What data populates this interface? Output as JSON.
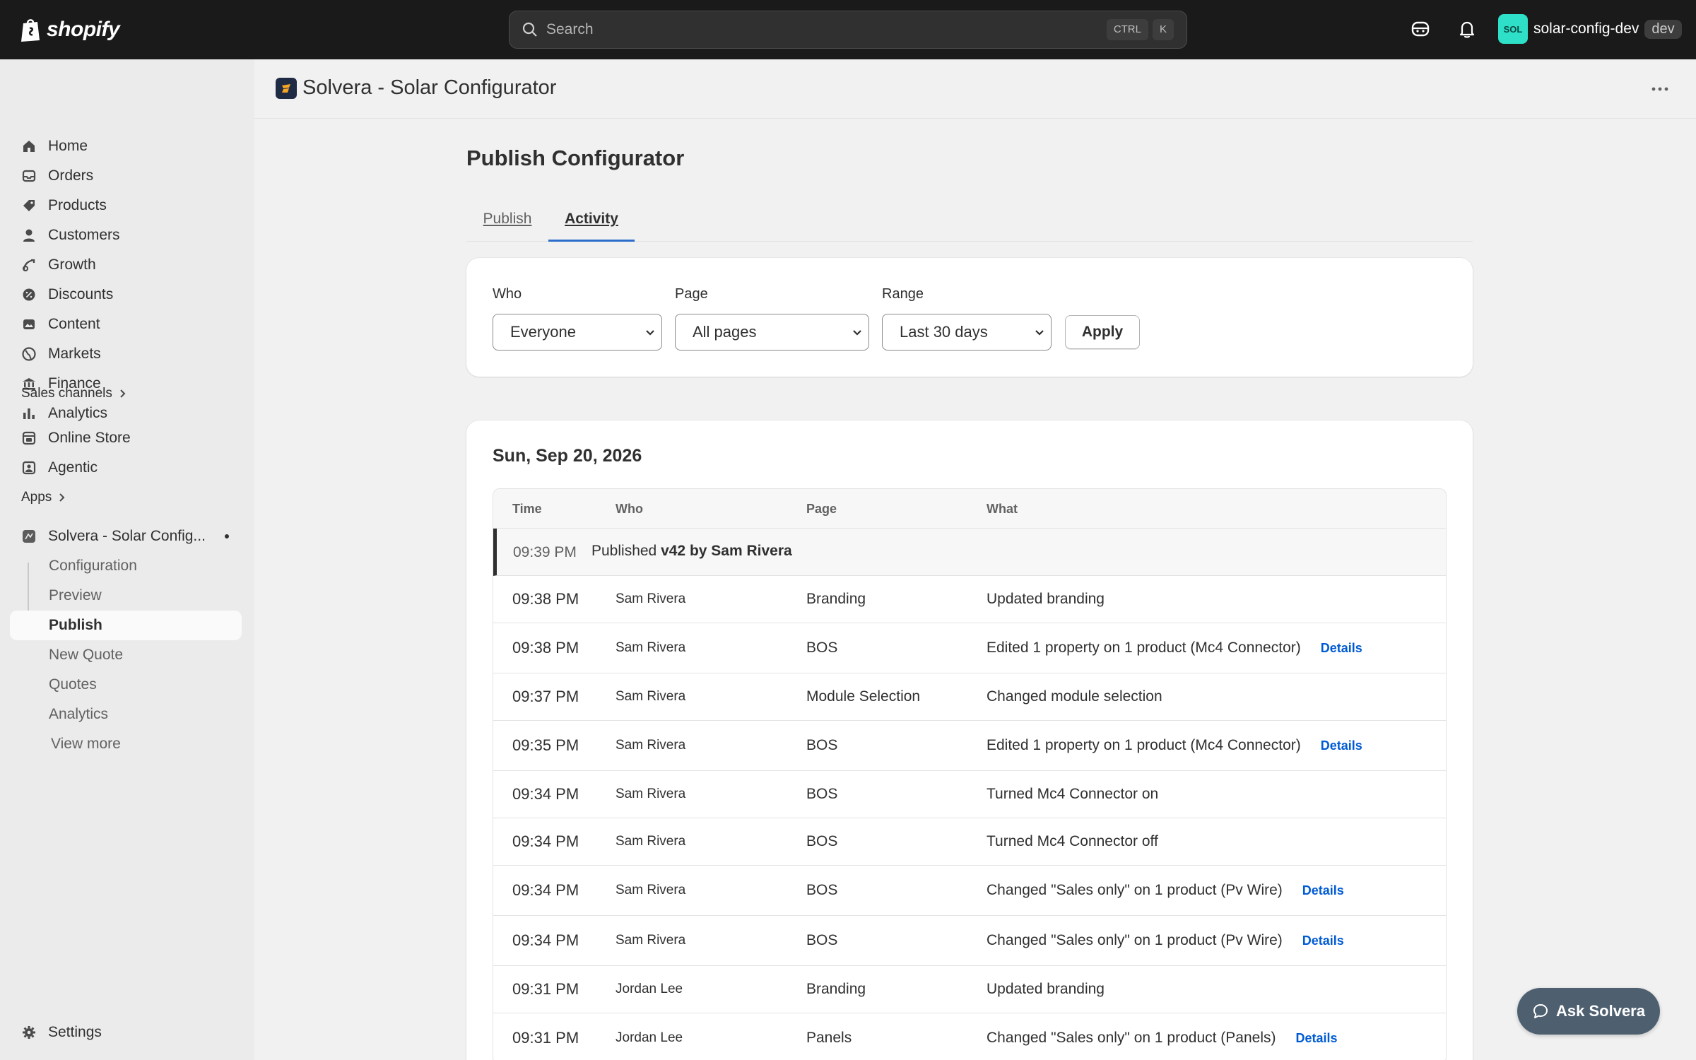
{
  "topbar": {
    "logo_text": "shopify",
    "search_placeholder": "Search",
    "shortcut_ctrl": "CTRL",
    "shortcut_key": "K",
    "store_avatar": "SOL",
    "store_name": "solar-config-dev",
    "store_badge": "dev"
  },
  "sidebar": {
    "items": [
      {
        "label": "Home",
        "icon": "home-icon"
      },
      {
        "label": "Orders",
        "icon": "inbox-icon"
      },
      {
        "label": "Products",
        "icon": "tag-icon"
      },
      {
        "label": "Customers",
        "icon": "person-icon"
      },
      {
        "label": "Growth",
        "icon": "growth-icon"
      },
      {
        "label": "Discounts",
        "icon": "discount-icon"
      },
      {
        "label": "Content",
        "icon": "content-icon"
      },
      {
        "label": "Markets",
        "icon": "globe-icon"
      },
      {
        "label": "Finance",
        "icon": "bank-icon"
      },
      {
        "label": "Analytics",
        "icon": "bar-chart-icon"
      }
    ],
    "sales_channels_label": "Sales channels",
    "channels": [
      {
        "label": "Online Store",
        "icon": "store-icon"
      },
      {
        "label": "Agentic",
        "icon": "agent-icon"
      }
    ],
    "apps_label": "Apps",
    "app_name": "Solvera - Solar Config...",
    "app_subitems": [
      "Configuration",
      "Preview",
      "Publish",
      "New Quote",
      "Quotes",
      "Analytics",
      "View more"
    ],
    "settings_label": "Settings"
  },
  "app_header": {
    "title": "Solvera - Solar Configurator"
  },
  "page": {
    "title": "Publish Configurator",
    "tabs": [
      "Publish",
      "Activity"
    ],
    "active_tab": "Activity"
  },
  "filters": {
    "who_label": "Who",
    "who_value": "Everyone",
    "page_label": "Page",
    "page_value": "All pages",
    "range_label": "Range",
    "range_value": "Last 30 days",
    "apply_label": "Apply"
  },
  "activity": {
    "date": "Sun, Sep 20, 2026",
    "columns": [
      "Time",
      "Who",
      "Page",
      "What"
    ],
    "publish_event": {
      "time": "09:39 PM",
      "prefix": "Published",
      "detail": "v42 by Sam Rivera"
    },
    "details_label": "Details",
    "rows": [
      {
        "time": "09:38 PM",
        "who": "Sam Rivera",
        "page": "Branding",
        "what": "Updated branding",
        "details": false
      },
      {
        "time": "09:38 PM",
        "who": "Sam Rivera",
        "page": "BOS",
        "what": "Edited 1 property on 1 product (Mc4 Connector)",
        "details": true
      },
      {
        "time": "09:37 PM",
        "who": "Sam Rivera",
        "page": "Module Selection",
        "what": "Changed module selection",
        "details": false
      },
      {
        "time": "09:35 PM",
        "who": "Sam Rivera",
        "page": "BOS",
        "what": "Edited 1 property on 1 product (Mc4 Connector)",
        "details": true
      },
      {
        "time": "09:34 PM",
        "who": "Sam Rivera",
        "page": "BOS",
        "what": "Turned Mc4 Connector on",
        "details": false
      },
      {
        "time": "09:34 PM",
        "who": "Sam Rivera",
        "page": "BOS",
        "what": "Turned Mc4 Connector off",
        "details": false
      },
      {
        "time": "09:34 PM",
        "who": "Sam Rivera",
        "page": "BOS",
        "what": "Changed \"Sales only\" on 1 product (Pv Wire)",
        "details": true
      },
      {
        "time": "09:34 PM",
        "who": "Sam Rivera",
        "page": "BOS",
        "what": "Changed \"Sales only\" on 1 product (Pv Wire)",
        "details": true
      },
      {
        "time": "09:31 PM",
        "who": "Jordan Lee",
        "page": "Branding",
        "what": "Updated branding",
        "details": false
      },
      {
        "time": "09:31 PM",
        "who": "Jordan Lee",
        "page": "Panels",
        "what": "Changed \"Sales only\" on 1 product (Panels)",
        "details": true
      }
    ]
  },
  "assistant": {
    "label": "Ask Solvera"
  }
}
